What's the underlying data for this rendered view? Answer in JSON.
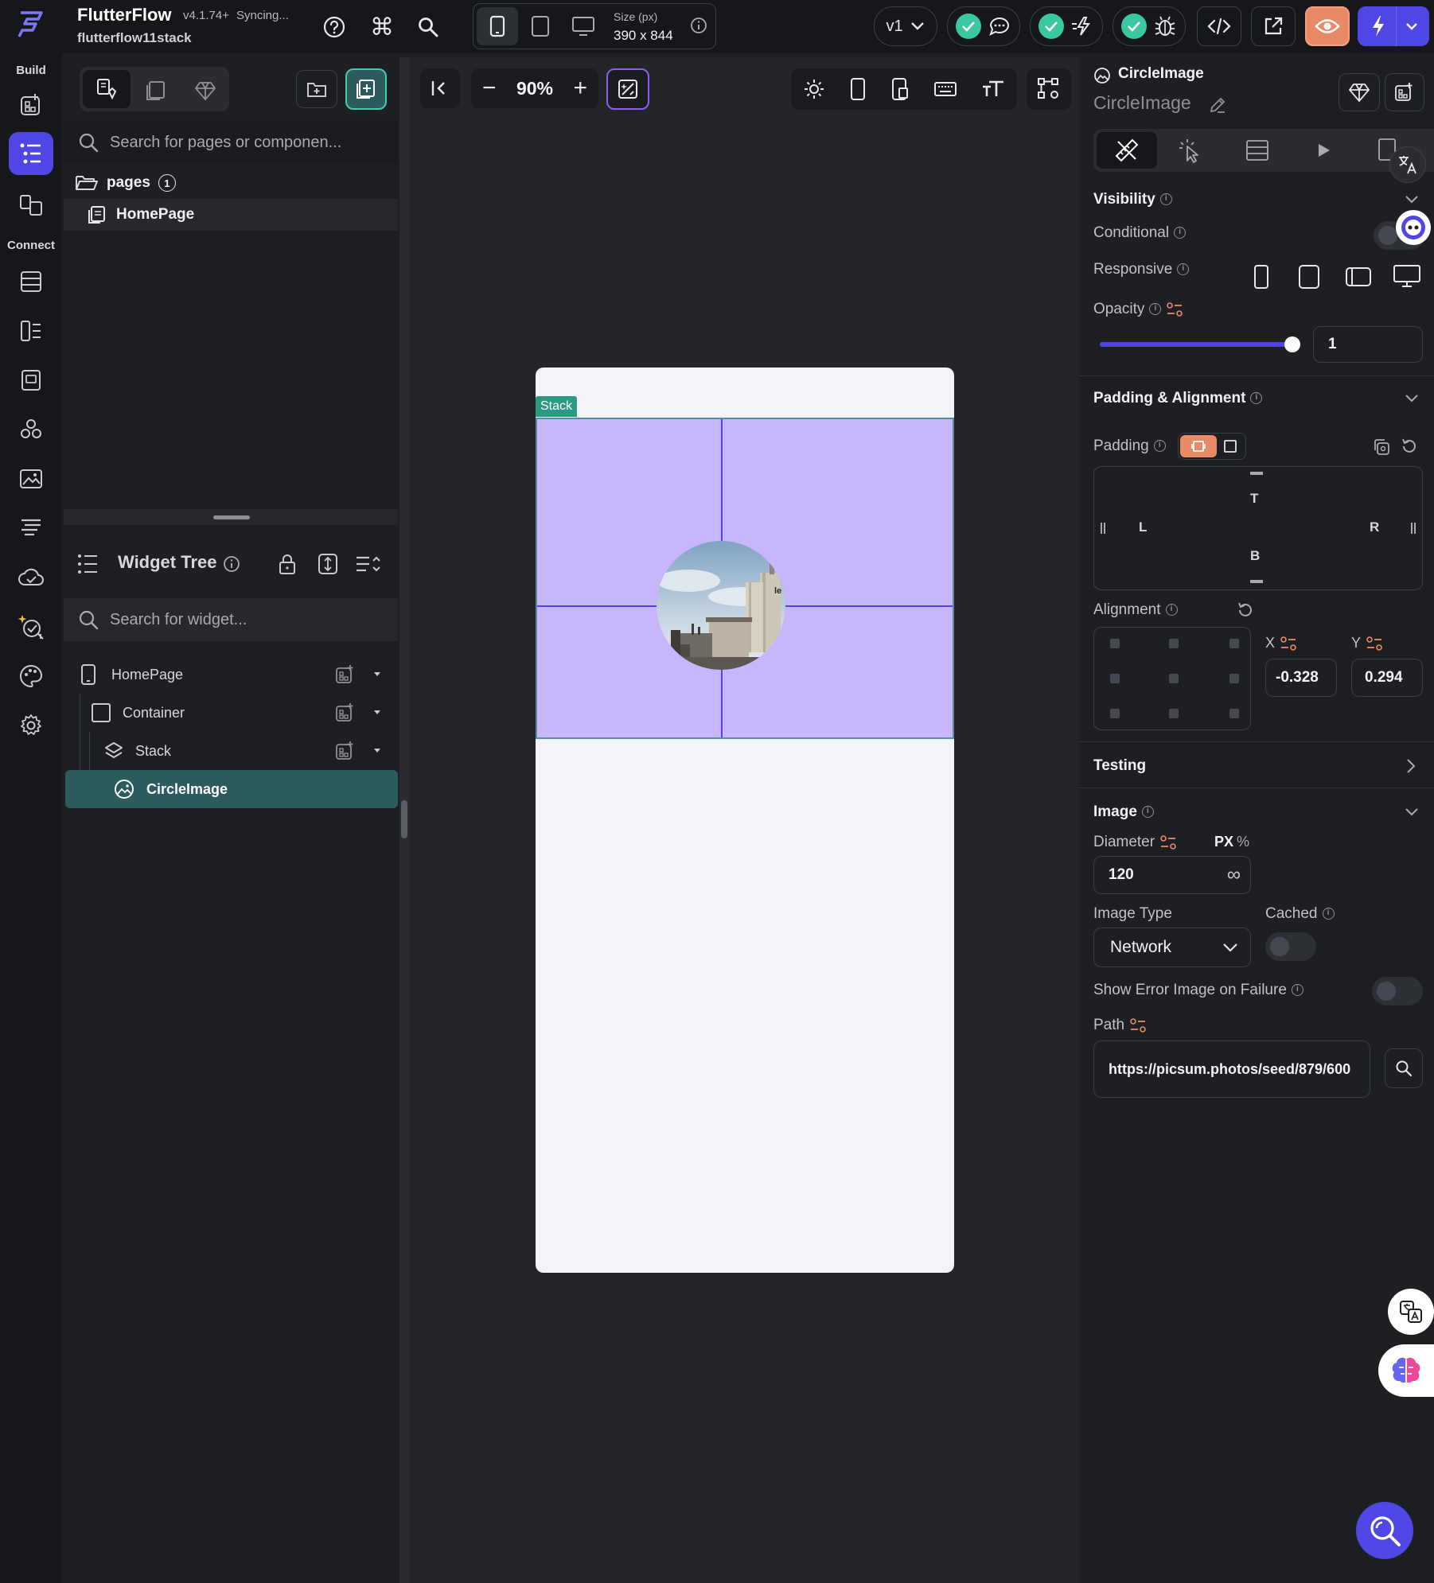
{
  "app": {
    "name": "FlutterFlow",
    "version": "v4.1.74+",
    "sync_status": "Syncing...",
    "project": "flutterflow11stack"
  },
  "topbar": {
    "size_label": "Size (px)",
    "size_value": "390 x 844",
    "branch": "v1"
  },
  "rail": {
    "build_label": "Build",
    "connect_label": "Connect"
  },
  "pages_panel": {
    "search_placeholder": "Search for pages or componen...",
    "folder_label": "pages",
    "folder_count": "1",
    "pages": [
      {
        "label": "HomePage"
      }
    ]
  },
  "widget_tree": {
    "title": "Widget Tree",
    "search_placeholder": "Search for widget...",
    "nodes": [
      {
        "label": "HomePage"
      },
      {
        "label": "Container"
      },
      {
        "label": "Stack"
      },
      {
        "label": "CircleImage"
      }
    ]
  },
  "canvas": {
    "zoom": "90%",
    "stack_tag": "Stack",
    "stack_color": "#c7b6fb",
    "selection_color": "#4f46e5"
  },
  "properties": {
    "widget_type": "CircleImage",
    "widget_name": "CircleImage",
    "visibility": {
      "title": "Visibility",
      "conditional_label": "Conditional",
      "responsive_label": "Responsive",
      "opacity_label": "Opacity",
      "opacity_value": "1",
      "opacity_fraction": 1
    },
    "padding_alignment": {
      "title": "Padding & Alignment",
      "padding_label": "Padding",
      "top": "T",
      "left": "L",
      "right": "R",
      "bottom": "B",
      "alignment_label": "Alignment",
      "x_label": "X",
      "y_label": "Y",
      "x_value": "-0.328",
      "y_value": "0.294"
    },
    "testing": {
      "title": "Testing"
    },
    "image": {
      "title": "Image",
      "diameter_label": "Diameter",
      "unit_px": "PX",
      "unit_pct": "%",
      "diameter_value": "120",
      "image_type_label": "Image Type",
      "image_type_value": "Network",
      "cached_label": "Cached",
      "show_error_label": "Show Error Image on Failure",
      "path_label": "Path",
      "path_value": "https://picsum.photos/seed/879/600"
    }
  },
  "colors": {
    "accent": "#4f46e5",
    "teal": "#2c5b5e",
    "check": "#39c8a0",
    "orange": "#e98a67"
  }
}
